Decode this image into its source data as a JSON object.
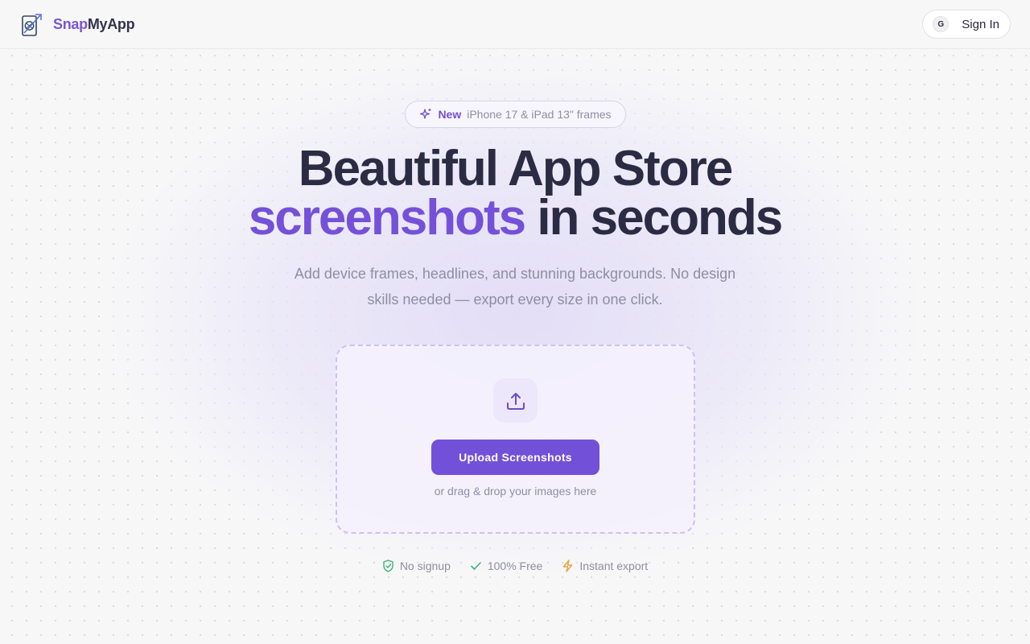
{
  "header": {
    "brand_part1": "Snap",
    "brand_part2": "MyApp",
    "signin_label": "Sign In",
    "signin_icon_letter": "G"
  },
  "hero": {
    "badge_strong": "New",
    "badge_text": "iPhone 17 & iPad 13\" frames",
    "title_line1": "Beautiful App Store",
    "title_accent": "screenshots",
    "title_rest": " in seconds",
    "subtitle": "Add device frames, headlines, and stunning backgrounds. No design skills needed — export every size in one click."
  },
  "upload": {
    "button_label": "Upload Screenshots",
    "hint": "or drag & drop your images here"
  },
  "features": [
    {
      "label": "No signup",
      "icon": "shield-check-icon",
      "color": "#3fae7a"
    },
    {
      "label": "100% Free",
      "icon": "check-icon",
      "color": "#3fae7a"
    },
    {
      "label": "Instant export",
      "icon": "lightning-icon",
      "color": "#e8a33a"
    }
  ],
  "colors": {
    "accent": "#7451d8",
    "heading": "#2b2b44",
    "muted": "#8e8ea2",
    "background": "#f7f7f8"
  }
}
